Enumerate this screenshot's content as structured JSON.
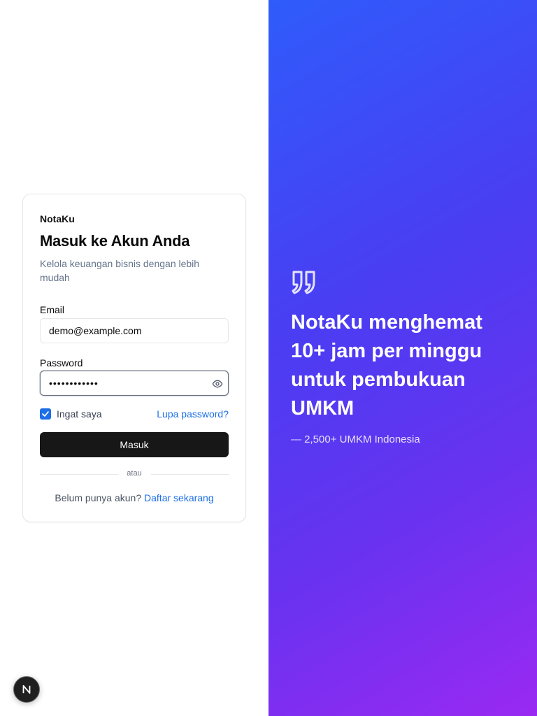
{
  "brand": "NotaKu",
  "login": {
    "title": "Masuk ke Akun Anda",
    "subtitle": "Kelola keuangan bisnis dengan lebih mudah",
    "email_label": "Email",
    "email_value": "demo@example.com",
    "password_label": "Password",
    "password_value": "••••••••••••",
    "remember_label": "Ingat saya",
    "remember_checked": true,
    "forgot_label": "Lupa password?",
    "submit_label": "Masuk",
    "divider_text": "atau",
    "signup_prompt": "Belum punya akun?",
    "signup_link": "Daftar sekarang"
  },
  "testimonial": {
    "icon": "quote-icon",
    "quote": "NotaKu menghemat 10+ jam per minggu untuk pembukuan UMKM",
    "author": "— 2,500+ UMKM Indonesia"
  },
  "dev_badge": {
    "icon": "nextjs-icon",
    "letter": "N"
  },
  "colors": {
    "accent": "#1d6fe8",
    "button_bg": "#171717",
    "gradient_start": "#2f5cfb",
    "gradient_end": "#9a29f2"
  }
}
